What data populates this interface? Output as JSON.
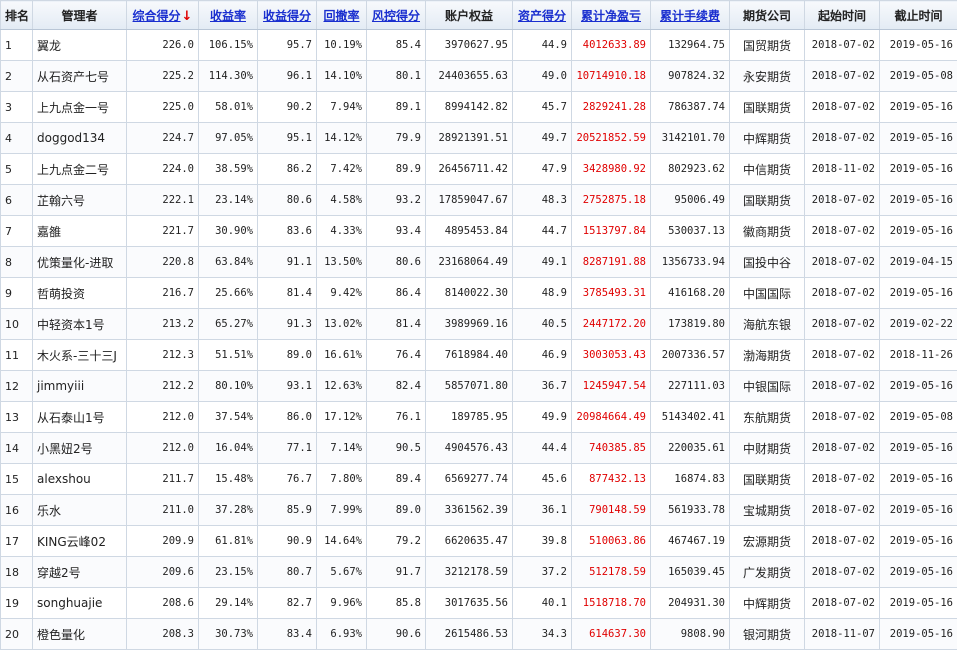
{
  "headers": {
    "rank": "排名",
    "manager": "管理者",
    "composite": "综合得分",
    "composite_arrow": "↓",
    "return_rate": "收益率",
    "return_score": "收益得分",
    "drawdown": "回撤率",
    "risk_score": "风控得分",
    "equity": "账户权益",
    "asset_score": "资产得分",
    "cum_pnl": "累计净盈亏",
    "cum_fee": "累计手续费",
    "broker": "期货公司",
    "start": "起始时间",
    "end": "截止时间"
  },
  "rows": [
    {
      "rank": "1",
      "manager": "翼龙",
      "composite": "226.0",
      "return_rate": "106.15%",
      "return_score": "95.7",
      "drawdown": "10.19%",
      "risk_score": "85.4",
      "equity": "3970627.95",
      "asset_score": "44.9",
      "cum_pnl": "4012633.89",
      "cum_fee": "132964.75",
      "broker": "国贸期货",
      "start": "2018-07-02",
      "end": "2019-05-16"
    },
    {
      "rank": "2",
      "manager": "从石资产七号",
      "composite": "225.2",
      "return_rate": "114.30%",
      "return_score": "96.1",
      "drawdown": "14.10%",
      "risk_score": "80.1",
      "equity": "24403655.63",
      "asset_score": "49.0",
      "cum_pnl": "10714910.18",
      "cum_fee": "907824.32",
      "broker": "永安期货",
      "start": "2018-07-02",
      "end": "2019-05-08"
    },
    {
      "rank": "3",
      "manager": "上九点金一号",
      "composite": "225.0",
      "return_rate": "58.01%",
      "return_score": "90.2",
      "drawdown": "7.94%",
      "risk_score": "89.1",
      "equity": "8994142.82",
      "asset_score": "45.7",
      "cum_pnl": "2829241.28",
      "cum_fee": "786387.74",
      "broker": "国联期货",
      "start": "2018-07-02",
      "end": "2019-05-16"
    },
    {
      "rank": "4",
      "manager": "doggod134",
      "composite": "224.7",
      "return_rate": "97.05%",
      "return_score": "95.1",
      "drawdown": "14.12%",
      "risk_score": "79.9",
      "equity": "28921391.51",
      "asset_score": "49.7",
      "cum_pnl": "20521852.59",
      "cum_fee": "3142101.70",
      "broker": "中辉期货",
      "start": "2018-07-02",
      "end": "2019-05-16"
    },
    {
      "rank": "5",
      "manager": "上九点金二号",
      "composite": "224.0",
      "return_rate": "38.59%",
      "return_score": "86.2",
      "drawdown": "7.42%",
      "risk_score": "89.9",
      "equity": "26456711.42",
      "asset_score": "47.9",
      "cum_pnl": "3428980.92",
      "cum_fee": "802923.62",
      "broker": "中信期货",
      "start": "2018-11-02",
      "end": "2019-05-16"
    },
    {
      "rank": "6",
      "manager": "芷翰六号",
      "composite": "222.1",
      "return_rate": "23.14%",
      "return_score": "80.6",
      "drawdown": "4.58%",
      "risk_score": "93.2",
      "equity": "17859047.67",
      "asset_score": "48.3",
      "cum_pnl": "2752875.18",
      "cum_fee": "95006.49",
      "broker": "国联期货",
      "start": "2018-07-02",
      "end": "2019-05-16"
    },
    {
      "rank": "7",
      "manager": "嘉雒",
      "composite": "221.7",
      "return_rate": "30.90%",
      "return_score": "83.6",
      "drawdown": "4.33%",
      "risk_score": "93.4",
      "equity": "4895453.84",
      "asset_score": "44.7",
      "cum_pnl": "1513797.84",
      "cum_fee": "530037.13",
      "broker": "徽商期货",
      "start": "2018-07-02",
      "end": "2019-05-16"
    },
    {
      "rank": "8",
      "manager": "优策量化-进取",
      "composite": "220.8",
      "return_rate": "63.84%",
      "return_score": "91.1",
      "drawdown": "13.50%",
      "risk_score": "80.6",
      "equity": "23168064.49",
      "asset_score": "49.1",
      "cum_pnl": "8287191.88",
      "cum_fee": "1356733.94",
      "broker": "国投中谷",
      "start": "2018-07-02",
      "end": "2019-04-15"
    },
    {
      "rank": "9",
      "manager": "哲萌投资",
      "composite": "216.7",
      "return_rate": "25.66%",
      "return_score": "81.4",
      "drawdown": "9.42%",
      "risk_score": "86.4",
      "equity": "8140022.30",
      "asset_score": "48.9",
      "cum_pnl": "3785493.31",
      "cum_fee": "416168.20",
      "broker": "中国国际",
      "start": "2018-07-02",
      "end": "2019-05-16"
    },
    {
      "rank": "10",
      "manager": "中轻资本1号",
      "composite": "213.2",
      "return_rate": "65.27%",
      "return_score": "91.3",
      "drawdown": "13.02%",
      "risk_score": "81.4",
      "equity": "3989969.16",
      "asset_score": "40.5",
      "cum_pnl": "2447172.20",
      "cum_fee": "173819.80",
      "broker": "海航东银",
      "start": "2018-07-02",
      "end": "2019-02-22"
    },
    {
      "rank": "11",
      "manager": "木火系-三十三J",
      "composite": "212.3",
      "return_rate": "51.51%",
      "return_score": "89.0",
      "drawdown": "16.61%",
      "risk_score": "76.4",
      "equity": "7618984.40",
      "asset_score": "46.9",
      "cum_pnl": "3003053.43",
      "cum_fee": "2007336.57",
      "broker": "渤海期货",
      "start": "2018-07-02",
      "end": "2018-11-26"
    },
    {
      "rank": "12",
      "manager": "jimmyiii",
      "composite": "212.2",
      "return_rate": "80.10%",
      "return_score": "93.1",
      "drawdown": "12.63%",
      "risk_score": "82.4",
      "equity": "5857071.80",
      "asset_score": "36.7",
      "cum_pnl": "1245947.54",
      "cum_fee": "227111.03",
      "broker": "中银国际",
      "start": "2018-07-02",
      "end": "2019-05-16"
    },
    {
      "rank": "13",
      "manager": "从石泰山1号",
      "composite": "212.0",
      "return_rate": "37.54%",
      "return_score": "86.0",
      "drawdown": "17.12%",
      "risk_score": "76.1",
      "equity": "189785.95",
      "asset_score": "49.9",
      "cum_pnl": "20984664.49",
      "cum_fee": "5143402.41",
      "broker": "东航期货",
      "start": "2018-07-02",
      "end": "2019-05-08"
    },
    {
      "rank": "14",
      "manager": "小黑妞2号",
      "composite": "212.0",
      "return_rate": "16.04%",
      "return_score": "77.1",
      "drawdown": "7.14%",
      "risk_score": "90.5",
      "equity": "4904576.43",
      "asset_score": "44.4",
      "cum_pnl": "740385.85",
      "cum_fee": "220035.61",
      "broker": "中财期货",
      "start": "2018-07-02",
      "end": "2019-05-16"
    },
    {
      "rank": "15",
      "manager": "alexshou",
      "composite": "211.7",
      "return_rate": "15.48%",
      "return_score": "76.7",
      "drawdown": "7.80%",
      "risk_score": "89.4",
      "equity": "6569277.74",
      "asset_score": "45.6",
      "cum_pnl": "877432.13",
      "cum_fee": "16874.83",
      "broker": "国联期货",
      "start": "2018-07-02",
      "end": "2019-05-16"
    },
    {
      "rank": "16",
      "manager": "乐水",
      "composite": "211.0",
      "return_rate": "37.28%",
      "return_score": "85.9",
      "drawdown": "7.99%",
      "risk_score": "89.0",
      "equity": "3361562.39",
      "asset_score": "36.1",
      "cum_pnl": "790148.59",
      "cum_fee": "561933.78",
      "broker": "宝城期货",
      "start": "2018-07-02",
      "end": "2019-05-16"
    },
    {
      "rank": "17",
      "manager": "KING云峰02",
      "composite": "209.9",
      "return_rate": "61.81%",
      "return_score": "90.9",
      "drawdown": "14.64%",
      "risk_score": "79.2",
      "equity": "6620635.47",
      "asset_score": "39.8",
      "cum_pnl": "510063.86",
      "cum_fee": "467467.19",
      "broker": "宏源期货",
      "start": "2018-07-02",
      "end": "2019-05-16"
    },
    {
      "rank": "18",
      "manager": "穿越2号",
      "composite": "209.6",
      "return_rate": "23.15%",
      "return_score": "80.7",
      "drawdown": "5.67%",
      "risk_score": "91.7",
      "equity": "3212178.59",
      "asset_score": "37.2",
      "cum_pnl": "512178.59",
      "cum_fee": "165039.45",
      "broker": "广发期货",
      "start": "2018-07-02",
      "end": "2019-05-16"
    },
    {
      "rank": "19",
      "manager": "songhuajie",
      "composite": "208.6",
      "return_rate": "29.14%",
      "return_score": "82.7",
      "drawdown": "9.96%",
      "risk_score": "85.8",
      "equity": "3017635.56",
      "asset_score": "40.1",
      "cum_pnl": "1518718.70",
      "cum_fee": "204931.30",
      "broker": "中辉期货",
      "start": "2018-07-02",
      "end": "2019-05-16"
    },
    {
      "rank": "20",
      "manager": "橙色量化",
      "composite": "208.3",
      "return_rate": "30.73%",
      "return_score": "83.4",
      "drawdown": "6.93%",
      "risk_score": "90.6",
      "equity": "2615486.53",
      "asset_score": "34.3",
      "cum_pnl": "614637.30",
      "cum_fee": "9808.90",
      "broker": "银河期货",
      "start": "2018-11-07",
      "end": "2019-05-16"
    }
  ],
  "colors": {
    "link_blue": "#1a2fcf",
    "pnl_red": "#e00000",
    "grid": "#cfd8e3",
    "header_bg": "#e3ebf4"
  }
}
